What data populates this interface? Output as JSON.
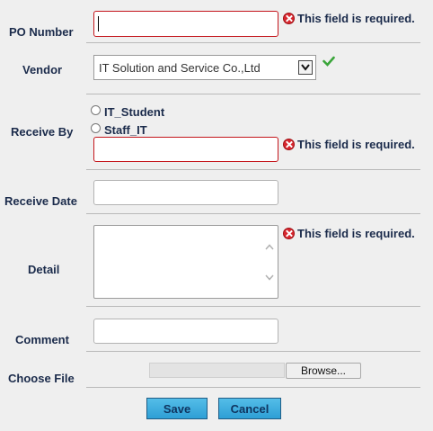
{
  "fields": {
    "po_number": {
      "label": "PO Number",
      "value": "",
      "error": "This field is required."
    },
    "vendor": {
      "label": "Vendor",
      "selected": "IT Solution and Service Co.,Ltd",
      "valid_icon": "check-icon"
    },
    "receive_by": {
      "label": "Receive By",
      "options": [
        "IT_Student",
        "Staff_IT"
      ],
      "value": "",
      "error": "This field is required."
    },
    "receive_date": {
      "label": "Receive Date",
      "value": ""
    },
    "detail": {
      "label": "Detail",
      "value": "",
      "error": "This field is required."
    },
    "comment": {
      "label": "Comment",
      "value": ""
    },
    "file": {
      "label": "Choose File",
      "browse_label": "Browse..."
    }
  },
  "actions": {
    "save_label": "Save",
    "cancel_label": "Cancel"
  },
  "colors": {
    "error": "#d7262e",
    "valid": "#3aa53a",
    "button": "#3bb0e2"
  }
}
